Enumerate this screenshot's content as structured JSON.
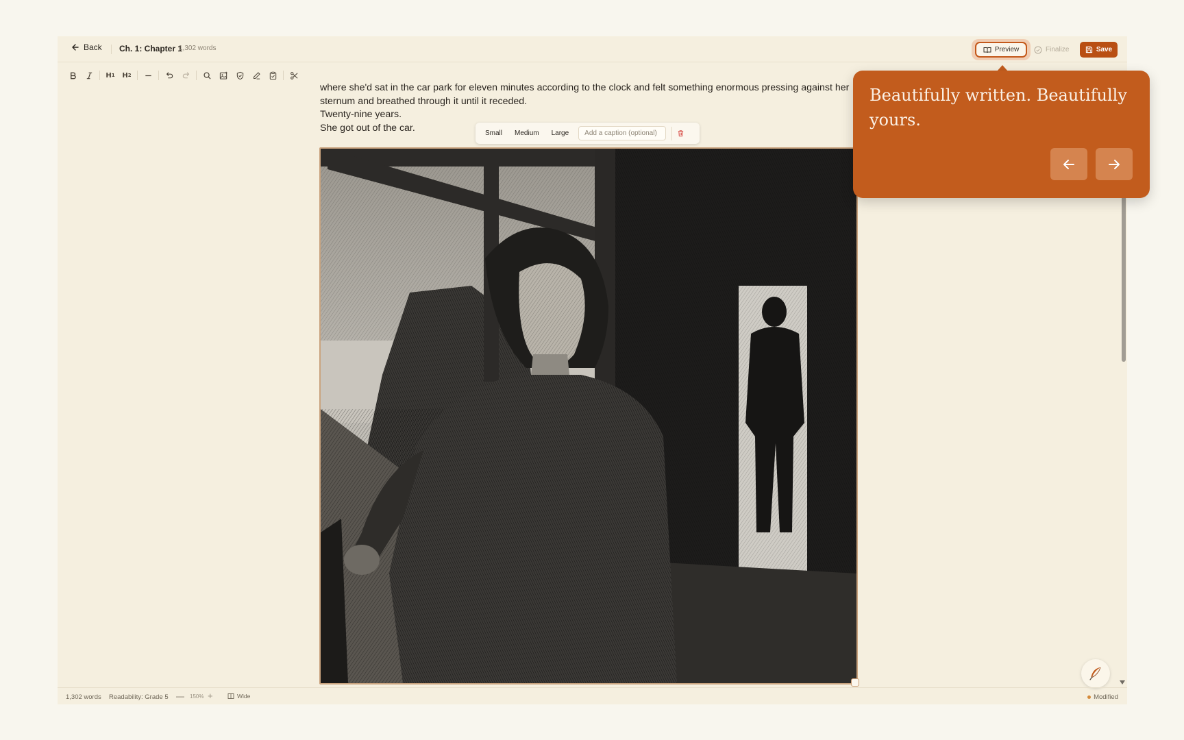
{
  "header": {
    "back_label": "Back",
    "chapter_title": "Ch. 1: Chapter 1",
    "word_count": "1,302 words",
    "preview_label": "Preview",
    "finalize_label": "Finalize",
    "save_label": "Save"
  },
  "toolbar": {
    "buttons": [
      "bold-icon",
      "italic-icon",
      "heading-1",
      "heading-2",
      "horizontal-rule-icon",
      "undo-icon",
      "redo-icon",
      "search-icon",
      "image-icon",
      "shield-icon",
      "pen-icon",
      "clipboard-icon",
      "scissors-icon"
    ],
    "h1_label": "H",
    "h2_label": "H"
  },
  "prose": {
    "lines": [
      "where she'd sat in the car park for eleven minutes according to the clock and felt something enormous pressing against her sternum and breathed through it until it receded.",
      "Twenty-nine years.",
      "She got out of the car."
    ]
  },
  "image_toolbar": {
    "sizes": [
      "Small",
      "Medium",
      "Large"
    ],
    "caption_placeholder": "Add a caption (optional)"
  },
  "footer": {
    "words": "1,302 words",
    "readability": "Readability: Grade 5",
    "zoom_out": "—",
    "zoom": "150%",
    "zoom_in": "+",
    "wide": "Wide",
    "status": "Modified"
  },
  "tour": {
    "text": "Beautifully written. Beautifully yours."
  },
  "colors": {
    "accent": "#c25c1d",
    "save_bg": "#b94f13",
    "page_bg": "#f5efdf"
  }
}
